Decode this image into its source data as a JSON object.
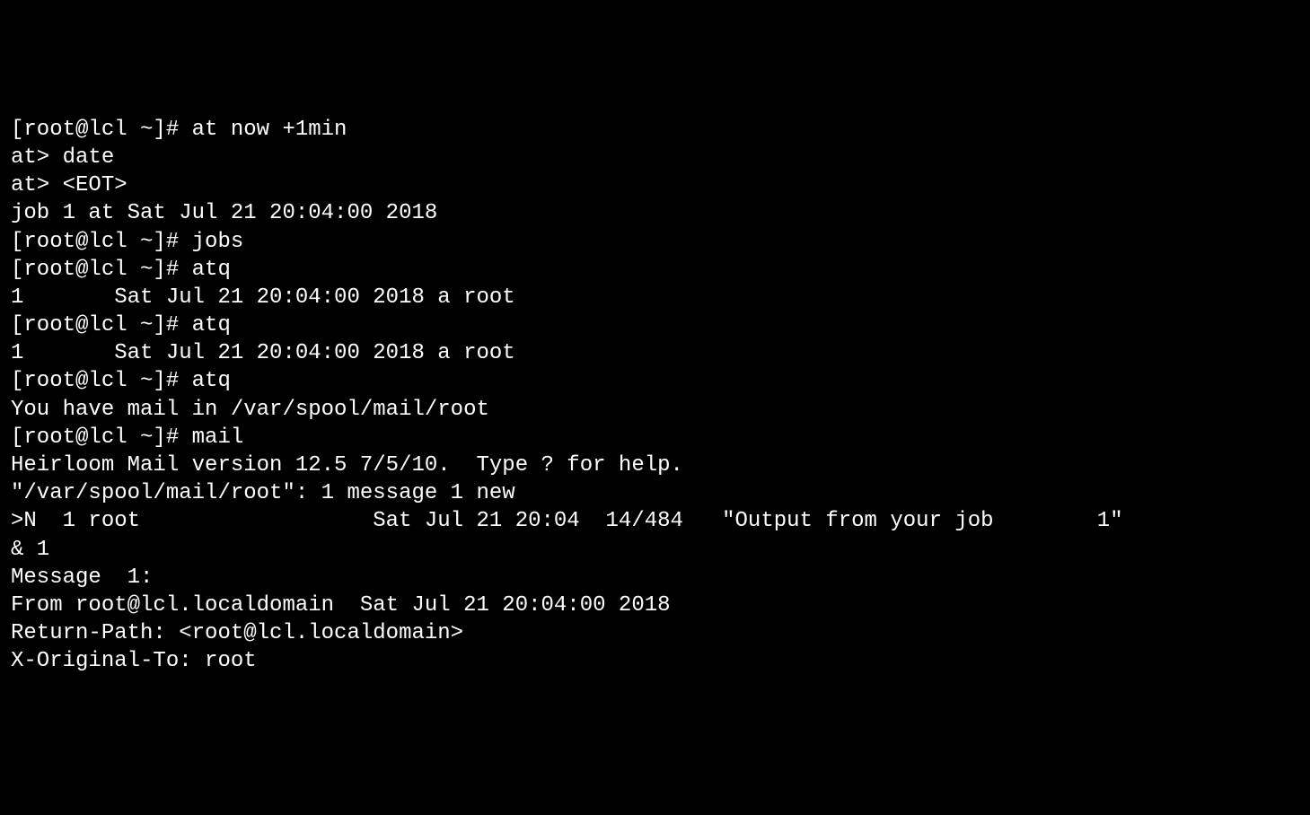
{
  "terminal": {
    "lines": [
      "[root@lcl ~]# at now +1min",
      "at> date",
      "at> <EOT>",
      "job 1 at Sat Jul 21 20:04:00 2018",
      "[root@lcl ~]# jobs",
      "[root@lcl ~]# atq",
      "1       Sat Jul 21 20:04:00 2018 a root",
      "[root@lcl ~]# atq",
      "1       Sat Jul 21 20:04:00 2018 a root",
      "[root@lcl ~]# atq",
      "You have mail in /var/spool/mail/root",
      "[root@lcl ~]# mail",
      "Heirloom Mail version 12.5 7/5/10.  Type ? for help.",
      "\"/var/spool/mail/root\": 1 message 1 new",
      ">N  1 root                  Sat Jul 21 20:04  14/484   \"Output from your job        1\"",
      "& 1",
      "Message  1:",
      "From root@lcl.localdomain  Sat Jul 21 20:04:00 2018",
      "Return-Path: <root@lcl.localdomain>",
      "X-Original-To: root"
    ]
  }
}
